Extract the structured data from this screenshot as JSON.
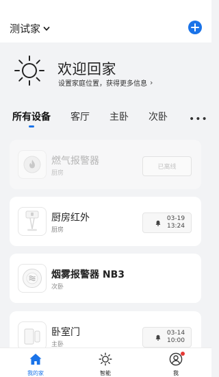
{
  "header": {
    "home_name": "测试家"
  },
  "welcome": {
    "title": "欢迎回家",
    "subtitle": "设置家庭位置，获得更多信息",
    "subtitle_arrow": "›"
  },
  "tabs": [
    {
      "label": "所有设备",
      "active": true
    },
    {
      "label": "客厅",
      "active": false
    },
    {
      "label": "主卧",
      "active": false
    },
    {
      "label": "次卧",
      "active": false
    }
  ],
  "tabs_more": "•••",
  "devices": [
    {
      "name": "燃气报警器",
      "room": "厨房",
      "status": "已离线",
      "icon": "flame-icon",
      "offline": true
    },
    {
      "name": "厨房红外",
      "room": "厨房",
      "time": [
        "03-19",
        "13:24"
      ],
      "icon": "infrared-sensor-icon"
    },
    {
      "name": "烟雾报警器 NB3",
      "room": "次卧",
      "icon": "smoke-detector-icon"
    },
    {
      "name": "卧室门",
      "room": "主卧",
      "time": [
        "03-14",
        "10:00"
      ],
      "icon": "door-sensor-icon"
    }
  ],
  "nav": [
    {
      "label": "我的家",
      "icon": "home-icon",
      "active": true
    },
    {
      "label": "智能",
      "icon": "sun-icon",
      "active": false
    },
    {
      "label": "我",
      "icon": "user-icon",
      "active": false,
      "badge": true
    }
  ],
  "colors": {
    "accent": "#1a73e8",
    "badge": "#e53935",
    "page_bg": "#f2f3f5"
  }
}
